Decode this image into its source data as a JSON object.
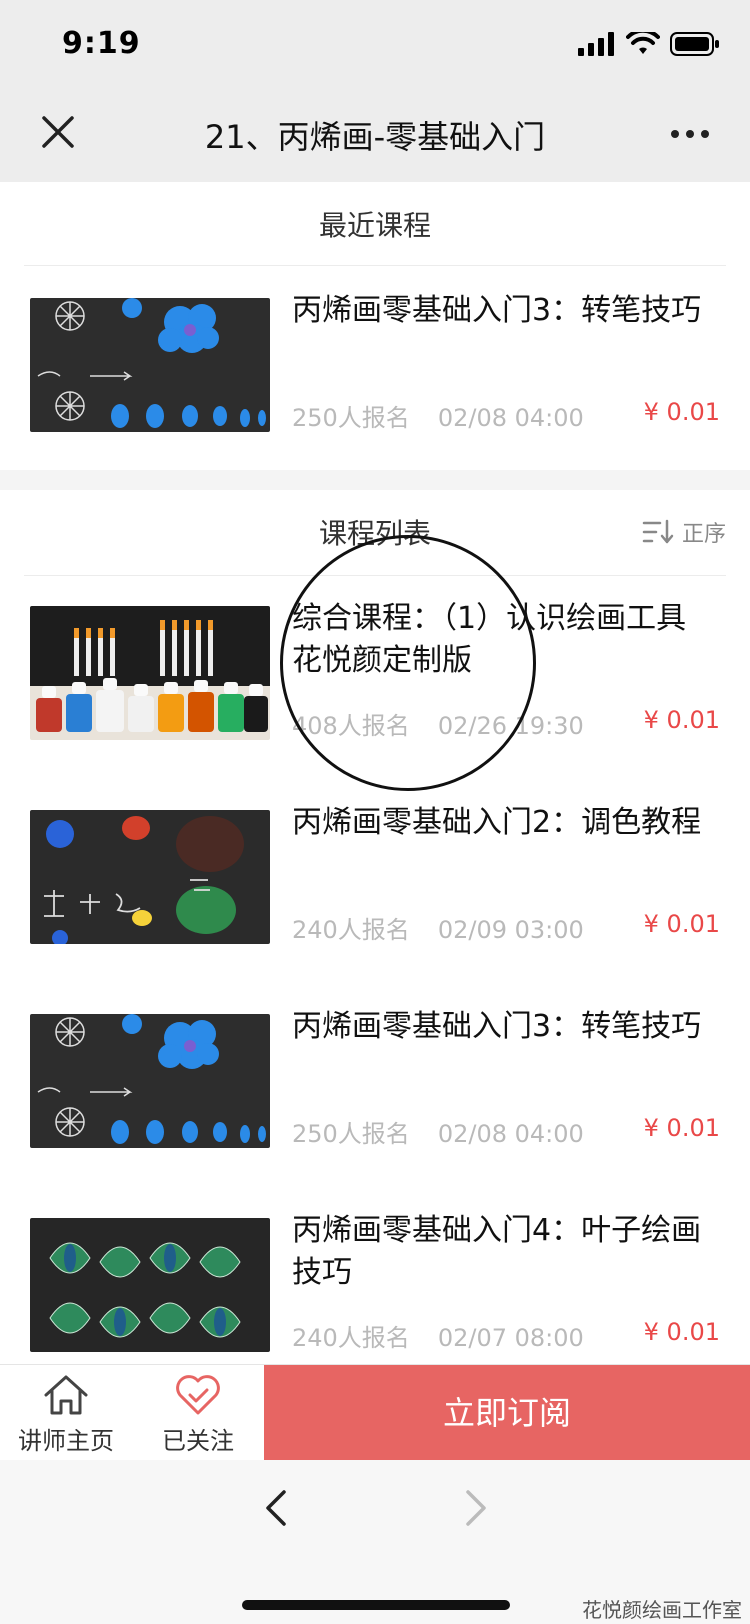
{
  "status_bar": {
    "time": "9:19"
  },
  "nav": {
    "title": "21、丙烯画-零基础入门",
    "close_icon": "close-icon",
    "more_icon": "more-dots-icon"
  },
  "recent": {
    "header": "最近课程",
    "items": [
      {
        "title": "丙烯画零基础入门3：转笔技巧",
        "enrolled": "250人报名",
        "datetime": "02/08 04:00",
        "price": "¥ 0.01",
        "thumb": "blue-flower-strokes"
      }
    ]
  },
  "list": {
    "header": "课程列表",
    "sort_label": "正序",
    "items": [
      {
        "title": "综合课程：（1）认识绘画工具 花悦颜定制版",
        "enrolled": "408人报名",
        "datetime": "02/26 19:30",
        "price": "¥ 0.01",
        "thumb": "paint-bottles-brushes"
      },
      {
        "title": "丙烯画零基础入门2：调色教程",
        "enrolled": "240人报名",
        "datetime": "02/09 03:00",
        "price": "¥ 0.01",
        "thumb": "color-mixing"
      },
      {
        "title": "丙烯画零基础入门3：转笔技巧",
        "enrolled": "250人报名",
        "datetime": "02/08 04:00",
        "price": "¥ 0.01",
        "thumb": "blue-flower-strokes"
      },
      {
        "title": "丙烯画零基础入门4：叶子绘画技巧",
        "enrolled": "240人报名",
        "datetime": "02/07 08:00",
        "price": "¥ 0.01",
        "thumb": "green-leaves"
      }
    ]
  },
  "bottom_bar": {
    "lecturer_label": "讲师主页",
    "follow_label": "已关注",
    "subscribe_label": "立即订阅"
  },
  "watermark": "花悦颜绘画工作室",
  "colors": {
    "accent": "#e76563",
    "price": "#e94848",
    "meta": "#b9b9b9"
  }
}
